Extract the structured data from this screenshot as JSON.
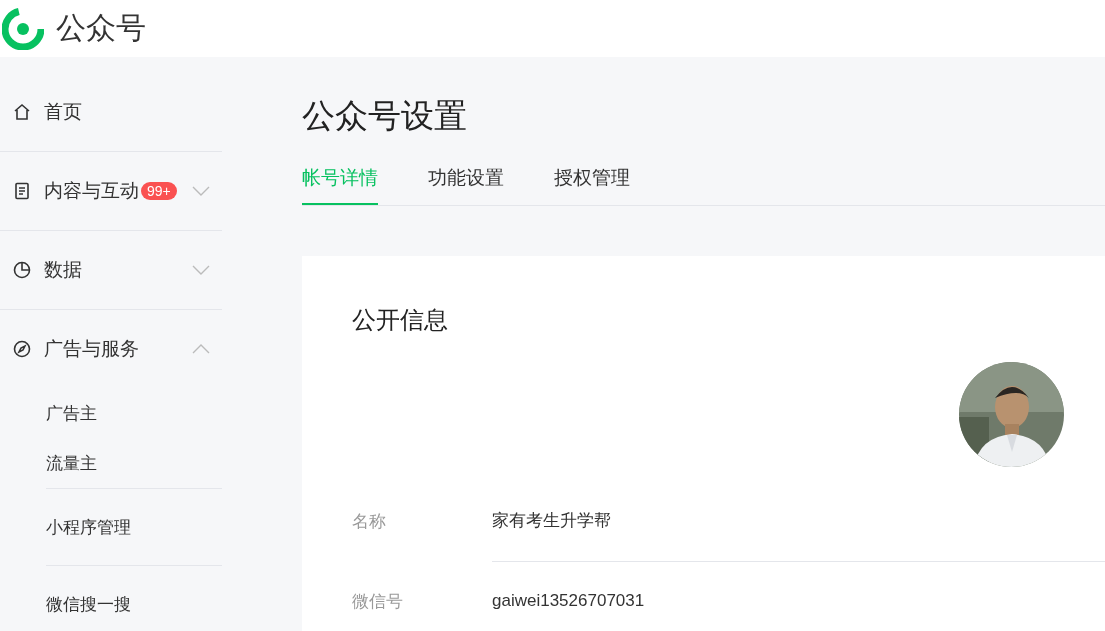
{
  "header": {
    "brand": "公众号"
  },
  "sidebar": {
    "items": [
      {
        "label": "首页",
        "kind": "section"
      },
      {
        "label": "内容与互动",
        "kind": "section",
        "badge": "99+",
        "expanded": false
      },
      {
        "label": "数据",
        "kind": "section",
        "expanded": false
      },
      {
        "label": "广告与服务",
        "kind": "section",
        "expanded": true,
        "children": [
          {
            "label": "广告主"
          },
          {
            "label": "流量主"
          }
        ]
      },
      {
        "label": "小程序管理",
        "kind": "link"
      },
      {
        "label": "微信搜一搜",
        "kind": "link"
      }
    ]
  },
  "page": {
    "title": "公众号设置"
  },
  "tabs": [
    {
      "label": "帐号详情",
      "selected": true
    },
    {
      "label": "功能设置",
      "selected": false
    },
    {
      "label": "授权管理",
      "selected": false
    }
  ],
  "card": {
    "title": "公开信息",
    "fields": [
      {
        "label": "名称",
        "value": "家有考生升学帮"
      },
      {
        "label": "微信号",
        "value": "gaiwei13526707031"
      }
    ]
  }
}
